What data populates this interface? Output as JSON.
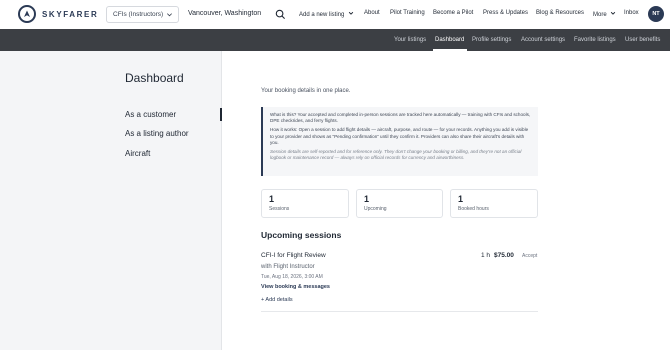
{
  "brand": {
    "name": "SKYFARER"
  },
  "search": {
    "category": "CFIs (Instructors)",
    "location": "Vancouver, Washington"
  },
  "nav": {
    "add_listing": "Add a new listing",
    "about": "About",
    "pilot_training": "Pilot Training",
    "become_pilot": "Become a Pilot",
    "press": "Press & Updates",
    "blog": "Blog & Resources",
    "more": "More",
    "inbox": "Inbox",
    "avatar_initials": "NT"
  },
  "subnav": {
    "tabs": [
      "Your listings",
      "Dashboard",
      "Profile settings",
      "Account settings",
      "Favorite listings",
      "User benefits"
    ],
    "active": "Dashboard"
  },
  "sidebar": {
    "title": "Dashboard",
    "items": [
      "As a customer",
      "As a listing author",
      "Aircraft"
    ]
  },
  "main": {
    "intro": "Your booking details in one place.",
    "info": {
      "what": "What is this? Your accepted and completed in-person sessions are tracked here automatically — training with CFIs and schools, DPE checkrides, and ferry flights.",
      "how": "How it works: Open a session to add flight details — aircraft, purpose, and route — for your records. Anything you add is visible to your provider and shows as “Pending confirmation” until they confirm it. Providers can also share their aircraft’s details with you.",
      "note": "Session details are self-reported and for reference only. They don’t change your booking or billing, and they’re not an official logbook or maintenance record — always rely on official records for currency and airworthiness."
    },
    "stats": [
      {
        "value": "1",
        "label": "Sessions"
      },
      {
        "value": "1",
        "label": "Upcoming"
      },
      {
        "value": "1",
        "label": "Booked hours"
      }
    ],
    "upcoming_title": "Upcoming sessions",
    "session": {
      "title": "CFI-I for Flight Review",
      "with": "with Flight Instructor",
      "date": "Tue, Aug 18, 2026, 3:00 AM",
      "duration": "1 h",
      "price": "$75.00",
      "status": "Accept",
      "view_link": "View booking & messages",
      "add_details": "+ Add details"
    }
  }
}
